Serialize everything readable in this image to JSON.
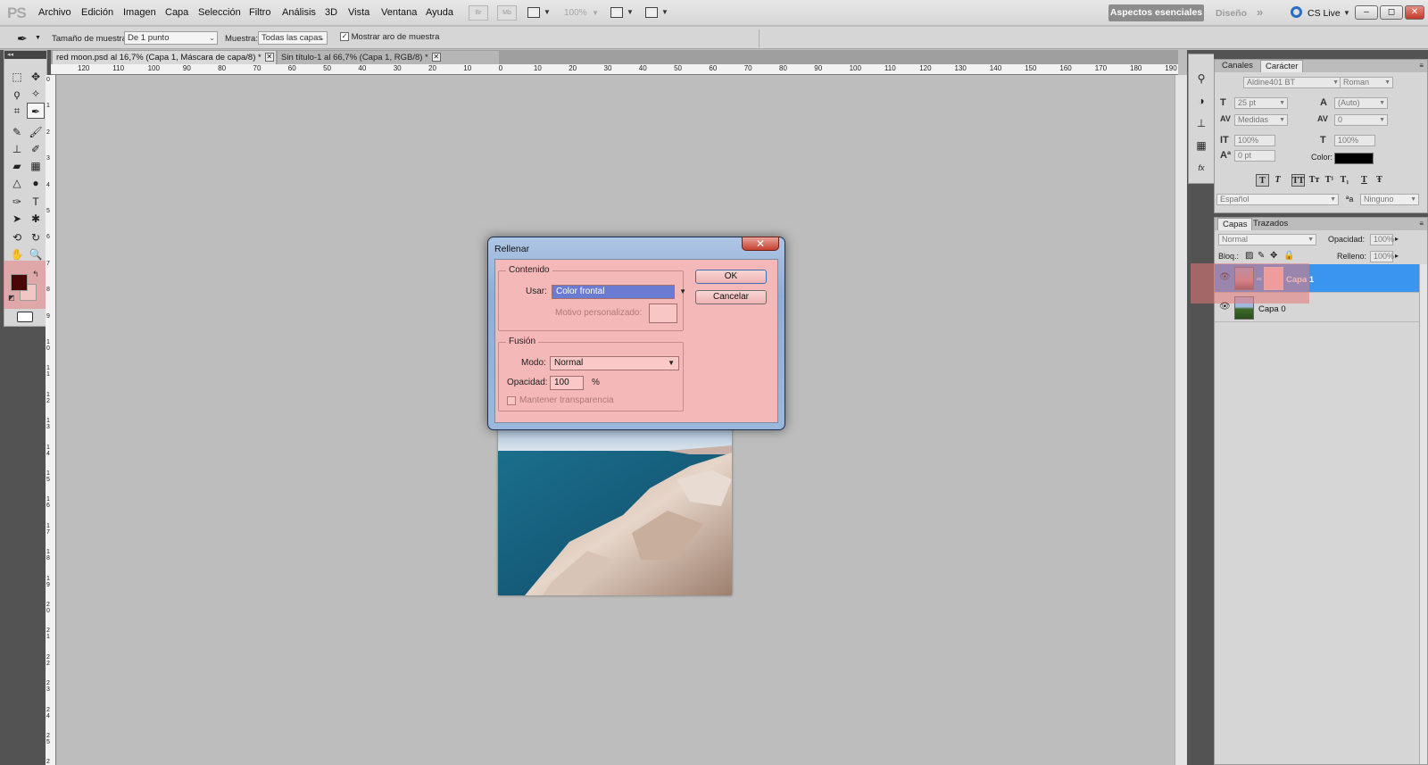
{
  "menubar": {
    "logo": "PS",
    "items": [
      "Archivo",
      "Edición",
      "Imagen",
      "Capa",
      "Selección",
      "Filtro",
      "Análisis",
      "3D",
      "Vista",
      "Ventana",
      "Ayuda"
    ],
    "bridge_icon": "Br",
    "minibridge_icon": "Mb",
    "zoom": "100%",
    "workspace_active": "Aspectos esenciales",
    "workspace_other": "Diseño",
    "more": "»",
    "cslive": "CS Live",
    "minimize": "–",
    "restore": "◻",
    "close": "✕"
  },
  "options": {
    "sample_size_label": "Tamaño de muestra:",
    "sample_size_value": "De 1 punto",
    "sample_label": "Muestra:",
    "sample_value": "Todas las capas",
    "show_ring_label": "Mostrar aro de muestra",
    "show_ring_checked": true
  },
  "tabs": [
    {
      "label": "red moon.psd al 16,7% (Capa 1, Máscara de capa/8) *",
      "close": "✕"
    },
    {
      "label": "Sin título-1 al 66,7% (Capa 1, RGB/8) *",
      "close": "✕"
    }
  ],
  "ruler": {
    "h_labels": [
      "120",
      "110",
      "100",
      "90",
      "80",
      "70",
      "60",
      "50",
      "40",
      "30",
      "20",
      "10",
      "0",
      "10",
      "20",
      "30",
      "40",
      "50",
      "60",
      "70",
      "80",
      "90",
      "100",
      "110",
      "120",
      "130",
      "140",
      "150",
      "160",
      "170",
      "180",
      "190"
    ],
    "v_labels": [
      "0",
      "1",
      "2",
      "3",
      "4",
      "5",
      "6",
      "7",
      "8",
      "9",
      "1 0",
      "1 1",
      "1 2",
      "1 3",
      "1 4",
      "1 5",
      "1 6",
      "1 7",
      "1 8",
      "1 9",
      "2 0",
      "2 1",
      "2 2",
      "2 3",
      "2 4",
      "2 5",
      "2 6"
    ]
  },
  "toolbox": {
    "head": "◂◂",
    "fg_color": "#4a0707",
    "bg_color": "#f3c6c6"
  },
  "dialog": {
    "title": "Rellenar",
    "close": "✕",
    "content_legend": "Contenido",
    "use_label": "Usar:",
    "use_value": "Color frontal",
    "pattern_label": "Motivo personalizado:",
    "blend_legend": "Fusión",
    "mode_label": "Modo:",
    "mode_value": "Normal",
    "opacity_label": "Opacidad:",
    "opacity_value": "100",
    "opacity_unit": "%",
    "preserve_label": "Mantener transparencia",
    "ok": "OK",
    "cancel": "Cancelar"
  },
  "character": {
    "tabs": [
      "Canales",
      "Carácter"
    ],
    "font_family": "Aldine401 BT",
    "font_style": "Roman",
    "size": "25 pt",
    "leading": "(Auto)",
    "kerning": "Medidas",
    "tracking": "0",
    "vscale": "100%",
    "hscale": "100%",
    "baseline": "0 pt",
    "color_label": "Color:",
    "color": "#000000",
    "language": "Español",
    "antialias_label": "ªa",
    "antialias": "Ninguno",
    "format_buttons": [
      "T",
      "T",
      "TT",
      "Tт",
      "T¹",
      "T₁",
      "T",
      "Ŧ"
    ]
  },
  "layers": {
    "tabs": [
      "Capas",
      "Trazados"
    ],
    "blend_mode": "Normal",
    "opacity_label": "Opacidad:",
    "opacity": "100%",
    "lock_label": "Bloq.:",
    "fill_label": "Relleno:",
    "fill": "100%",
    "items": [
      {
        "name": "Capa 1",
        "selected": true
      },
      {
        "name": "Capa 0",
        "selected": false
      }
    ]
  },
  "colors": {
    "highlight": "#e88282",
    "selected_layer": "#3a95f0"
  }
}
